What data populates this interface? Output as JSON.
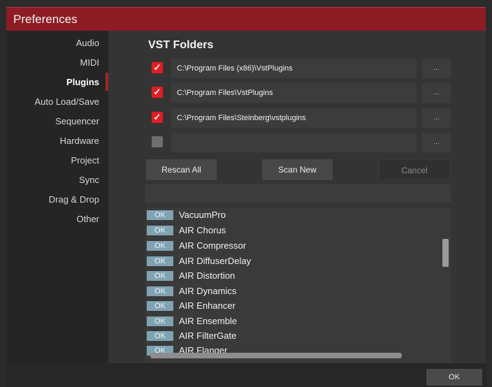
{
  "window": {
    "title": "Preferences"
  },
  "sidebar": {
    "items": [
      {
        "label": "Audio"
      },
      {
        "label": "MIDI"
      },
      {
        "label": "Plugins"
      },
      {
        "label": "Auto Load/Save"
      },
      {
        "label": "Sequencer"
      },
      {
        "label": "Hardware"
      },
      {
        "label": "Project"
      },
      {
        "label": "Sync"
      },
      {
        "label": "Drag & Drop"
      },
      {
        "label": "Other"
      }
    ],
    "active": "Plugins"
  },
  "vst": {
    "heading": "VST Folders",
    "folders": [
      {
        "checked": true,
        "path": "C:\\Program Files (x86)\\VstPlugins"
      },
      {
        "checked": true,
        "path": "C:\\Program Files\\VstPlugins"
      },
      {
        "checked": true,
        "path": "C:\\Program Files\\Steinberg\\vstplugins"
      },
      {
        "checked": false,
        "path": ""
      }
    ],
    "browse_label": "...",
    "check_glyph": "✓"
  },
  "buttons": {
    "rescan": "Rescan All",
    "scan_new": "Scan New",
    "cancel": "Cancel"
  },
  "plugins": {
    "status_label": "OK",
    "items": [
      "VacuumPro",
      "AIR Chorus",
      "AIR Compressor",
      "AIR DiffuserDelay",
      "AIR Distortion",
      "AIR Dynamics",
      "AIR Enhancer",
      "AIR Ensemble",
      "AIR FilterGate",
      "AIR Flanger"
    ]
  },
  "footer": {
    "ok_label": "OK"
  },
  "colors": {
    "accent": "#8e1c24",
    "check": "#e01d24",
    "ok_badge": "#7fa3b3"
  }
}
